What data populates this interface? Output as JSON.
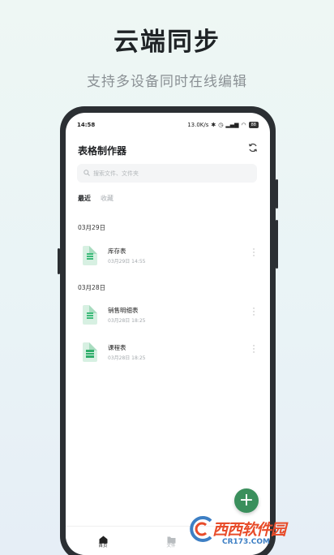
{
  "promo": {
    "headline": "云端同步",
    "subline": "支持多设备同时在线编辑"
  },
  "status_bar": {
    "time": "14:58",
    "network_speed": "13.0K/s",
    "battery": "88"
  },
  "app": {
    "title": "表格制作器",
    "search_placeholder": "搜索文件、文件夹"
  },
  "tabs": [
    {
      "label": "最近",
      "active": true
    },
    {
      "label": "收藏",
      "active": false
    }
  ],
  "groups": [
    {
      "date": "03月29日",
      "files": [
        {
          "name": "库存表",
          "time": "03月29日 14:55",
          "icon": "spreadsheet-icon"
        }
      ]
    },
    {
      "date": "03月28日",
      "files": [
        {
          "name": "销售明细表",
          "time": "03月28日 18:25",
          "icon": "spreadsheet-icon"
        },
        {
          "name": "课程表",
          "time": "03月28日 18:25",
          "icon": "timetable-icon"
        }
      ]
    }
  ],
  "fab": {
    "label": "+"
  },
  "bottom_nav": [
    {
      "label": "首页",
      "icon": "home-icon",
      "active": true
    },
    {
      "label": "文件",
      "icon": "folder-icon",
      "active": false
    }
  ],
  "watermark": {
    "text": "西西软件园",
    "url": "CR173.COM"
  },
  "colors": {
    "accent": "#3a8f5c",
    "file_icon_bg": "#d7f0e2",
    "file_icon_fg": "#3dbb7a"
  }
}
